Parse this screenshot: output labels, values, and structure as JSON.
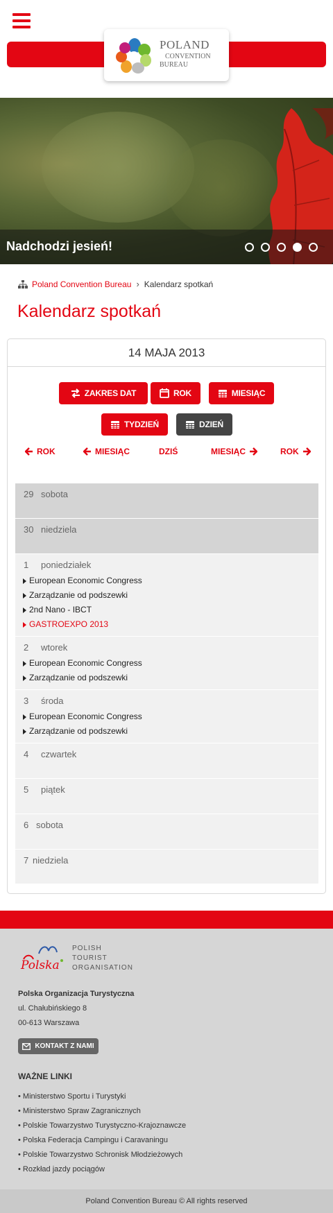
{
  "header": {
    "logo_line1": "POLAND",
    "logo_line2": "CONVENTION",
    "logo_line3": "BUREAU",
    "accent_color": "#e30613"
  },
  "hero": {
    "caption": "Nadchodzi jesień!",
    "slide_count": 5,
    "active_slide": 4
  },
  "breadcrumb": {
    "home": "Poland Convention Bureau",
    "separator": "›",
    "current": "Kalendarz spotkań"
  },
  "page_title": "Kalendarz spotkań",
  "calendar": {
    "date_heading": "14 MAJA 2013",
    "view_buttons": {
      "range": "ZAKRES DAT",
      "year": "ROK",
      "month": "MIESIĄC",
      "week": "TYDZIEŃ",
      "day": "DZIEŃ"
    },
    "nav": {
      "prev_year": "ROK",
      "prev_month": "MIESIĄC",
      "today": "DZIŚ",
      "next_month": "MIESIĄC",
      "next_year": "ROK"
    },
    "days": [
      {
        "num": "29",
        "name": "sobota",
        "events": []
      },
      {
        "num": "30",
        "name": "niedziela",
        "events": []
      },
      {
        "num": "1",
        "name": "poniedziałek",
        "events": [
          {
            "title": "European Economic Congress",
            "highlight": false
          },
          {
            "title": "Zarządzanie od podszewki",
            "highlight": false
          },
          {
            "title": "2nd Nano - IBCT",
            "highlight": false
          },
          {
            "title": "GASTROEXPO 2013",
            "highlight": true
          }
        ]
      },
      {
        "num": "2",
        "name": "wtorek",
        "events": [
          {
            "title": "European Economic Congress",
            "highlight": false
          },
          {
            "title": "Zarządzanie od podszewki",
            "highlight": false
          }
        ]
      },
      {
        "num": "3",
        "name": "środa",
        "events": [
          {
            "title": "European Economic Congress",
            "highlight": false
          },
          {
            "title": "Zarządzanie od podszewki",
            "highlight": false
          }
        ]
      },
      {
        "num": "4",
        "name": "czwartek",
        "events": []
      },
      {
        "num": "5",
        "name": "piątek",
        "events": []
      },
      {
        "num": "6",
        "name": "sobota",
        "events": []
      },
      {
        "num": "7",
        "name": "niedziela",
        "events": []
      }
    ]
  },
  "footer": {
    "logo_word": "Polska",
    "pto_line1": "POLISH",
    "pto_line2": "TOURIST",
    "pto_line3": "ORGANISATION",
    "org_name": "Polska Organizacja Turystyczna",
    "street": "ul. Chałubińskiego 8",
    "city": "00-613 Warszawa",
    "contact_button": "KONTAKT Z NAMI",
    "links_title": "WAŻNE LINKI",
    "links": [
      "Ministerstwo Sportu i Turystyki",
      "Ministerstwo Spraw Zagranicznych",
      "Polskie Towarzystwo Turystyczno-Krajoznawcze",
      "Polska Federacja Campingu i Caravaningu",
      "Polskie Towarzystwo Schronisk Młodzieżowych",
      "Rozkład jazdy pociągów"
    ],
    "copyright": "Poland Convention Bureau © All rights reserved"
  }
}
